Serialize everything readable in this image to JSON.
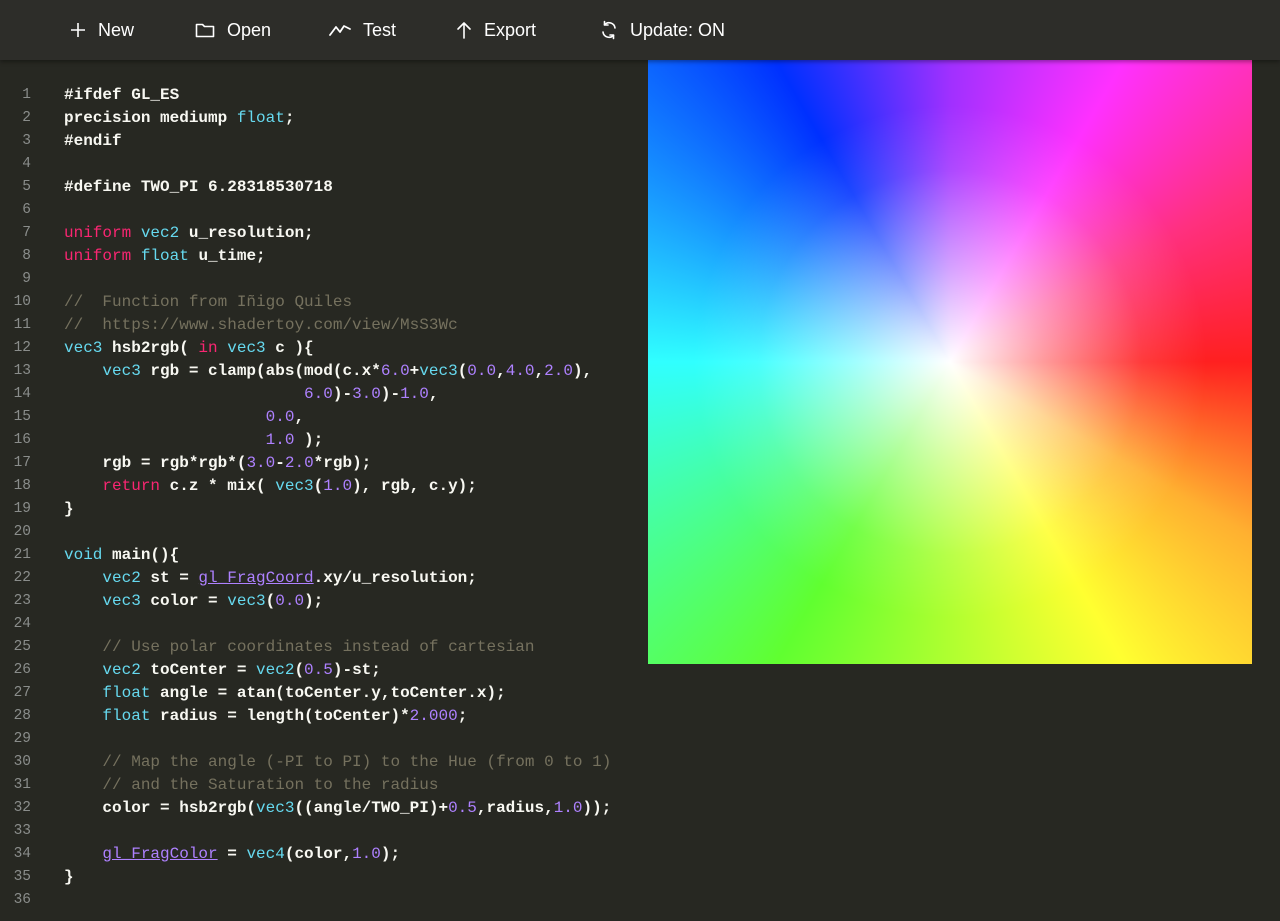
{
  "toolbar": {
    "buttons": [
      {
        "label": "New",
        "icon": "plus-icon"
      },
      {
        "label": "Open",
        "icon": "folder-icon"
      },
      {
        "label": "Test",
        "icon": "chart-line-icon"
      },
      {
        "label": "Export",
        "icon": "arrow-up-icon"
      },
      {
        "label": "Update: ON",
        "icon": "refresh-icon"
      }
    ]
  },
  "editor": {
    "lines": [
      [
        [
          "pp",
          "#ifdef GL_ES"
        ]
      ],
      [
        [
          "pp",
          "precision mediump "
        ],
        [
          "ty",
          "float"
        ],
        [
          "pp",
          ";"
        ]
      ],
      [
        [
          "pp",
          "#endif"
        ]
      ],
      [],
      [
        [
          "pp",
          "#define TWO_PI 6.28318530718"
        ]
      ],
      [],
      [
        [
          "kw",
          "uniform"
        ],
        [
          "p",
          " "
        ],
        [
          "ty",
          "vec2"
        ],
        [
          "p",
          " u_resolution;"
        ]
      ],
      [
        [
          "kw",
          "uniform"
        ],
        [
          "p",
          " "
        ],
        [
          "ty",
          "float"
        ],
        [
          "p",
          " u_time;"
        ]
      ],
      [],
      [
        [
          "cm",
          "//  Function from Iñigo Quiles"
        ]
      ],
      [
        [
          "cm",
          "//  https://www.shadertoy.com/view/MsS3Wc"
        ]
      ],
      [
        [
          "ty",
          "vec3"
        ],
        [
          "p",
          " hsb2rgb( "
        ],
        [
          "kw",
          "in"
        ],
        [
          "p",
          " "
        ],
        [
          "ty",
          "vec3"
        ],
        [
          "p",
          " c ){"
        ]
      ],
      [
        [
          "p",
          "    "
        ],
        [
          "ty",
          "vec3"
        ],
        [
          "p",
          " rgb = clamp(abs(mod(c.x*"
        ],
        [
          "num",
          "6.0"
        ],
        [
          "p",
          "+"
        ],
        [
          "ty",
          "vec3"
        ],
        [
          "p",
          "("
        ],
        [
          "num",
          "0.0"
        ],
        [
          "p",
          ","
        ],
        [
          "num",
          "4.0"
        ],
        [
          "p",
          ","
        ],
        [
          "num",
          "2.0"
        ],
        [
          "p",
          "),"
        ]
      ],
      [
        [
          "p",
          "                         "
        ],
        [
          "num",
          "6.0"
        ],
        [
          "p",
          ")-"
        ],
        [
          "num",
          "3.0"
        ],
        [
          "p",
          ")-"
        ],
        [
          "num",
          "1.0"
        ],
        [
          "p",
          ","
        ]
      ],
      [
        [
          "p",
          "                     "
        ],
        [
          "num",
          "0.0"
        ],
        [
          "p",
          ","
        ]
      ],
      [
        [
          "p",
          "                     "
        ],
        [
          "num",
          "1.0"
        ],
        [
          "p",
          " );"
        ]
      ],
      [
        [
          "p",
          "    rgb = rgb*rgb*("
        ],
        [
          "num",
          "3.0"
        ],
        [
          "p",
          "-"
        ],
        [
          "num",
          "2.0"
        ],
        [
          "p",
          "*rgb);"
        ]
      ],
      [
        [
          "p",
          "    "
        ],
        [
          "kw",
          "return"
        ],
        [
          "p",
          " c.z * mix( "
        ],
        [
          "ty",
          "vec3"
        ],
        [
          "p",
          "("
        ],
        [
          "num",
          "1.0"
        ],
        [
          "p",
          "), rgb, c.y);"
        ]
      ],
      [
        [
          "p",
          "}"
        ]
      ],
      [],
      [
        [
          "ty",
          "void"
        ],
        [
          "p",
          " main(){"
        ]
      ],
      [
        [
          "p",
          "    "
        ],
        [
          "ty",
          "vec2"
        ],
        [
          "p",
          " st = "
        ],
        [
          "bi",
          "gl_FragCoord"
        ],
        [
          "p",
          ".xy/u_resolution;"
        ]
      ],
      [
        [
          "p",
          "    "
        ],
        [
          "ty",
          "vec3"
        ],
        [
          "p",
          " color = "
        ],
        [
          "ty",
          "vec3"
        ],
        [
          "p",
          "("
        ],
        [
          "num",
          "0.0"
        ],
        [
          "p",
          ");"
        ]
      ],
      [],
      [
        [
          "p",
          "    "
        ],
        [
          "cm",
          "// Use polar coordinates instead of cartesian"
        ]
      ],
      [
        [
          "p",
          "    "
        ],
        [
          "ty",
          "vec2"
        ],
        [
          "p",
          " toCenter = "
        ],
        [
          "ty",
          "vec2"
        ],
        [
          "p",
          "("
        ],
        [
          "num",
          "0.5"
        ],
        [
          "p",
          ")-st;"
        ]
      ],
      [
        [
          "p",
          "    "
        ],
        [
          "ty",
          "float"
        ],
        [
          "p",
          " angle = atan(toCenter.y,toCenter.x);"
        ]
      ],
      [
        [
          "p",
          "    "
        ],
        [
          "ty",
          "float"
        ],
        [
          "p",
          " radius = length(toCenter)*"
        ],
        [
          "num",
          "2.000"
        ],
        [
          "p",
          ";"
        ]
      ],
      [],
      [
        [
          "p",
          "    "
        ],
        [
          "cm",
          "// Map the angle (-PI to PI) to the Hue (from 0 to 1)"
        ]
      ],
      [
        [
          "p",
          "    "
        ],
        [
          "cm",
          "// and the Saturation to the radius"
        ]
      ],
      [
        [
          "p",
          "    color = hsb2rgb("
        ],
        [
          "ty",
          "vec3"
        ],
        [
          "p",
          "((angle/TWO_PI)+"
        ],
        [
          "num",
          "0.5"
        ],
        [
          "p",
          ",radius,"
        ],
        [
          "num",
          "1.0"
        ],
        [
          "p",
          "));"
        ]
      ],
      [],
      [
        [
          "p",
          "    "
        ],
        [
          "bi",
          "gl_FragColor"
        ],
        [
          "p",
          " = "
        ],
        [
          "ty",
          "vec4"
        ],
        [
          "p",
          "(color,"
        ],
        [
          "num",
          "1.0"
        ],
        [
          "p",
          ");"
        ]
      ],
      [
        [
          "p",
          "}"
        ]
      ],
      []
    ]
  },
  "preview": {
    "description": "shader-output-canvas"
  },
  "colors": {
    "background": "#272822",
    "toolbar": "#2d2d29",
    "type": "#66d9ef",
    "keyword": "#f92672",
    "number": "#ae81ff",
    "comment": "#75715e",
    "text": "#f8f8f2",
    "line_number": "#8a8d8b"
  }
}
